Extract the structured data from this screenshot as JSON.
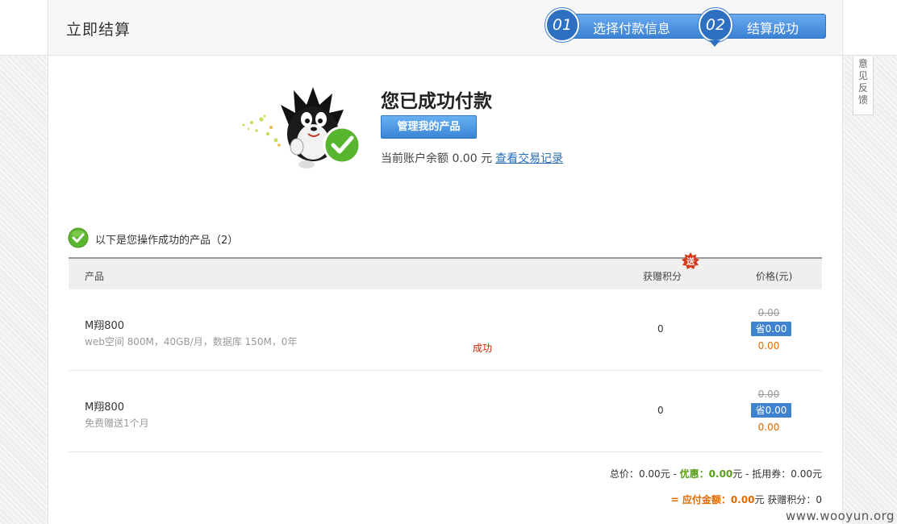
{
  "header": {
    "title": "立即结算",
    "steps": [
      {
        "num": "01",
        "label": "选择付款信息"
      },
      {
        "num": "02",
        "label": "结算成功"
      }
    ]
  },
  "feedback_label": "意见反馈",
  "success": {
    "title": "您已成功付款",
    "manage_button": "管理我的产品",
    "balance_text": "当前账户余额 0.00 元",
    "transactions_link": "查看交易记录"
  },
  "products": {
    "title": "以下是您操作成功的产品（2）",
    "columns": {
      "product": "产品",
      "points": "获赠积分",
      "price": "价格(元)"
    },
    "gift_badge": "送",
    "rows": [
      {
        "name": "M翔800",
        "desc": "web空间 800M，40GB/月，数据库 150M，0年",
        "status": "成功",
        "points": "0",
        "original": "0.00",
        "save": "省0.00",
        "final": "0.00"
      },
      {
        "name": "M翔800",
        "desc": "免费赠送1个月",
        "status": "",
        "points": "0",
        "original": "0.00",
        "save": "省0.00",
        "final": "0.00"
      }
    ]
  },
  "summary": {
    "total_label": "总价：",
    "total_value": "0.00元",
    "sep1": " - ",
    "discount_label": "优惠：",
    "discount_value": "0.00",
    "discount_unit": "元",
    "sep2": " - ",
    "voucher_label": "抵用券：",
    "voucher_value": "0.00元",
    "payable_prefix": "= ",
    "payable_label": "应付金额：",
    "payable_value": "0.00",
    "payable_unit": "元",
    "points_label": " 获赠积分：",
    "points_value": "0"
  },
  "watermark": "www.wooyun.org",
  "colors": {
    "accent": "#3a86d6",
    "success": "#5ab52f",
    "orange": "#e06a00",
    "red": "#cc2200"
  }
}
